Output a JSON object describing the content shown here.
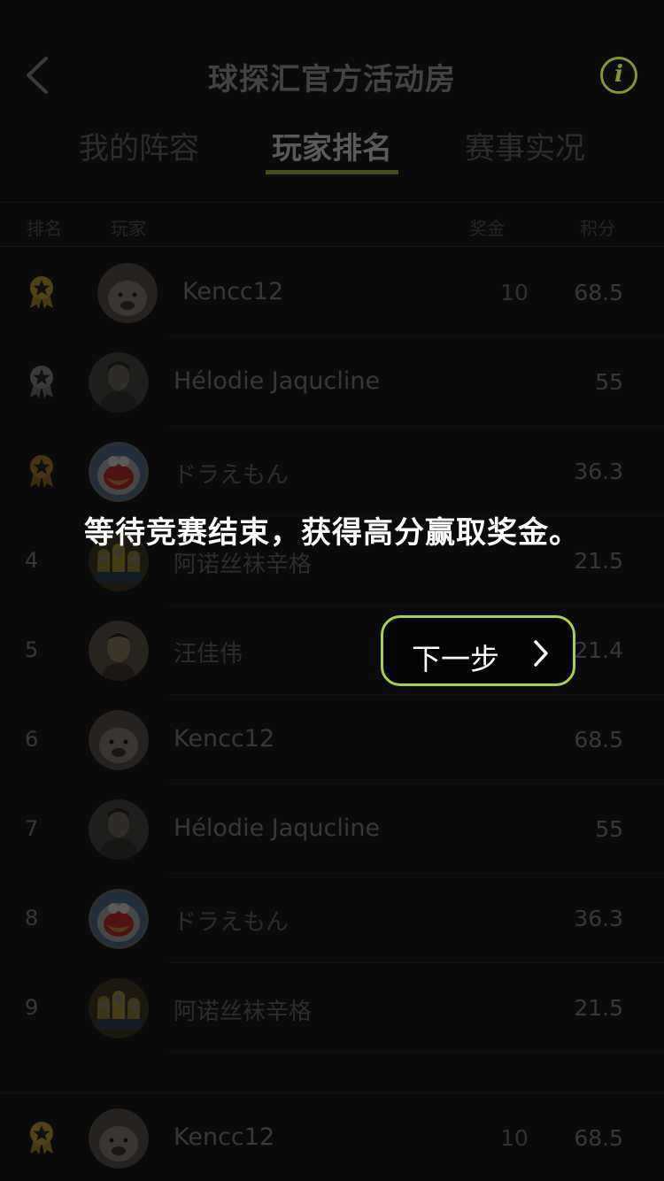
{
  "header": {
    "title": "球探汇官方活动房",
    "info_glyph": "i"
  },
  "tabs": [
    {
      "label": "我的阵容",
      "active": false
    },
    {
      "label": "玩家排名",
      "active": true
    },
    {
      "label": "赛事实况",
      "active": false
    }
  ],
  "columns": {
    "rank": "排名",
    "player": "玩家",
    "prize": "奖金",
    "score": "积分"
  },
  "rows": [
    {
      "rank": "",
      "medal": "gold-medal-icon",
      "avatar": "dog-avatar",
      "name": "Kencc12",
      "prize": "10",
      "score": "68.5"
    },
    {
      "rank": "",
      "medal": "silver-medal-icon",
      "avatar": "man-avatar",
      "name": "Hélodie Jaqucline",
      "prize": "",
      "score": "55"
    },
    {
      "rank": "",
      "medal": "bronze-medal-icon",
      "avatar": "doraemon-avatar",
      "name": "ドラえもん",
      "prize": "",
      "score": "36.3"
    },
    {
      "rank": "4",
      "medal": "",
      "avatar": "minions-avatar",
      "name": "阿诺丝袜辛格",
      "prize": "",
      "score": "21.5"
    },
    {
      "rank": "5",
      "medal": "",
      "avatar": "portrait-avatar",
      "name": "汪佳伟",
      "prize": "",
      "score": "21.4"
    },
    {
      "rank": "6",
      "medal": "",
      "avatar": "dog-avatar",
      "name": "Kencc12",
      "prize": "",
      "score": "68.5"
    },
    {
      "rank": "7",
      "medal": "",
      "avatar": "man-avatar",
      "name": "Hélodie Jaqucline",
      "prize": "",
      "score": "55"
    },
    {
      "rank": "8",
      "medal": "",
      "avatar": "doraemon-avatar",
      "name": "ドラえもん",
      "prize": "",
      "score": "36.3"
    },
    {
      "rank": "9",
      "medal": "",
      "avatar": "minions-avatar",
      "name": "阿诺丝袜辛格",
      "prize": "",
      "score": "21.5"
    }
  ],
  "my_row": {
    "medal": "gold-medal-icon",
    "avatar": "dog-avatar",
    "name": "Kencc12",
    "prize": "10",
    "score": "68.5"
  },
  "guide": {
    "message": "等待竞赛结束，获得高分赢取奖金。",
    "next_label": "下一步"
  },
  "colors": {
    "accent": "#c4ea4f",
    "button_border": "#a4d24a",
    "background": "#121212"
  }
}
